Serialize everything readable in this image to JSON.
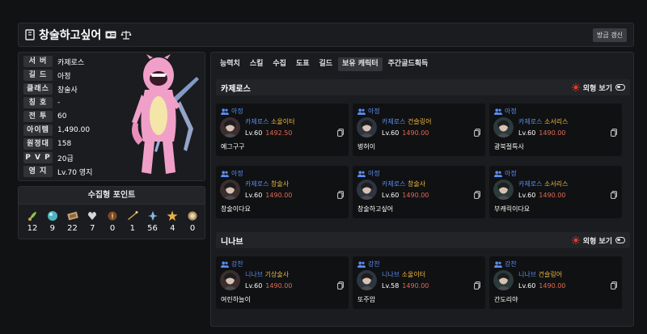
{
  "header": {
    "title": "창술하고싶어",
    "refresh_label": "방금 갱신"
  },
  "profile": {
    "rows": [
      {
        "label": "서 버",
        "value": "카제로스"
      },
      {
        "label": "길 드",
        "value": "아정"
      },
      {
        "label": "클래스",
        "value": "창술사"
      },
      {
        "label": "칭 호",
        "value": "-"
      },
      {
        "label": "전 투",
        "value": "60"
      },
      {
        "label": "아이템",
        "value": "1,490.00"
      },
      {
        "label": "원정대",
        "value": "158"
      },
      {
        "label": "P V P",
        "value": "20급"
      },
      {
        "label": "영 지",
        "value": "Lv.70 영지"
      }
    ]
  },
  "collect": {
    "title": "수집형 포인트",
    "items": [
      {
        "icon": "mokoko-seed-icon",
        "count": "12"
      },
      {
        "icon": "island-heart-icon",
        "count": "9"
      },
      {
        "icon": "great-art-icon",
        "count": "22"
      },
      {
        "icon": "giant-heart-icon",
        "count": "7"
      },
      {
        "icon": "ignea-token-icon",
        "count": "0"
      },
      {
        "icon": "sea-bounty-icon",
        "count": "1"
      },
      {
        "icon": "world-tree-leaf-icon",
        "count": "56"
      },
      {
        "icon": "orpheus-star-icon",
        "count": "4"
      },
      {
        "icon": "orgel-icon",
        "count": "0"
      }
    ]
  },
  "tabs": [
    {
      "label": "능력치"
    },
    {
      "label": "스킬"
    },
    {
      "label": "수집"
    },
    {
      "label": "도표"
    },
    {
      "label": "길드"
    },
    {
      "label": "보유 캐릭터",
      "active": true
    },
    {
      "label": "주간골드획득"
    }
  ],
  "appearance_label": "외형 보기",
  "sections": [
    {
      "server": "카제로스",
      "cards": [
        {
          "guild": "아정",
          "server": "카제로스",
          "class": "소울이터",
          "level": "Lv.60",
          "ilvl": "1492.50",
          "name": "예그구구"
        },
        {
          "guild": "아정",
          "server": "카제로스",
          "class": "건슬링어",
          "level": "Lv.60",
          "ilvl": "1490.00",
          "name": "병허이"
        },
        {
          "guild": "아정",
          "server": "카제로스",
          "class": "소서리스",
          "level": "Lv.60",
          "ilvl": "1490.00",
          "name": "광북절특사"
        },
        {
          "guild": "아정",
          "server": "카제로스",
          "class": "창술사",
          "level": "Lv.60",
          "ilvl": "1490.00",
          "name": "창술이다요"
        },
        {
          "guild": "아정",
          "server": "카제로스",
          "class": "창술사",
          "level": "Lv.60",
          "ilvl": "1490.00",
          "name": "창술하고싶어"
        },
        {
          "guild": "아정",
          "server": "카제로스",
          "class": "소서리스",
          "level": "Lv.60",
          "ilvl": "1490.00",
          "name": "부캐릭이다요"
        }
      ]
    },
    {
      "server": "니나브",
      "cards": [
        {
          "guild": "강찬",
          "server": "니나브",
          "class": "기상술사",
          "level": "Lv.60",
          "ilvl": "1490.00",
          "name": "여린하늘이"
        },
        {
          "guild": "강찬",
          "server": "니나브",
          "class": "소울이터",
          "level": "Lv.58",
          "ilvl": "1490.00",
          "name": "또주암"
        },
        {
          "guild": "강찬",
          "server": "니나브",
          "class": "건슬링어",
          "level": "Lv.60",
          "ilvl": "1490.00",
          "name": "간도리야"
        }
      ]
    }
  ],
  "colors": {
    "accent_blue": "#5b8def",
    "class_yellow": "#f1b83c",
    "ilvl_red": "#e06a54",
    "sun_red": "#e23b2e"
  }
}
